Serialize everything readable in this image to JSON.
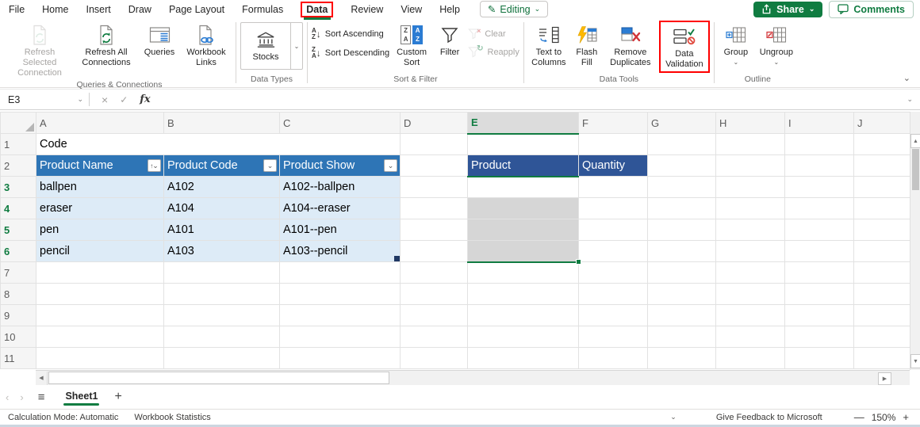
{
  "menu": {
    "items": [
      "File",
      "Home",
      "Insert",
      "Draw",
      "Page Layout",
      "Formulas",
      "Data",
      "Review",
      "View",
      "Help"
    ],
    "active": "Data",
    "editing_label": "Editing",
    "share_label": "Share",
    "comments_label": "Comments"
  },
  "ribbon": {
    "queries_group": {
      "label": "Queries & Connections",
      "refresh_selected": "Refresh Selected Connection",
      "refresh_all": "Refresh All Connections",
      "queries": "Queries",
      "workbook_links": "Workbook Links"
    },
    "data_types_group": {
      "label": "Data Types",
      "stocks": "Stocks"
    },
    "sort_filter_group": {
      "label": "Sort & Filter",
      "sort_ascending": "Sort Ascending",
      "sort_descending": "Sort Descending",
      "custom_sort": "Custom Sort",
      "filter": "Filter",
      "clear": "Clear",
      "reapply": "Reapply"
    },
    "data_tools_group": {
      "label": "Data Tools",
      "text_to_columns": "Text to Columns",
      "flash_fill": "Flash Fill",
      "remove_duplicates": "Remove Duplicates",
      "data_validation": "Data Validation"
    },
    "outline_group": {
      "label": "Outline",
      "group": "Group",
      "ungroup": "Ungroup"
    }
  },
  "formula_bar": {
    "cell_ref": "E3",
    "fx_label": "fx",
    "value": ""
  },
  "grid": {
    "columns": [
      "A",
      "B",
      "C",
      "D",
      "E",
      "F",
      "G",
      "H",
      "I",
      "J"
    ],
    "rows": [
      "1",
      "2",
      "3",
      "4",
      "5",
      "6",
      "7",
      "8",
      "9",
      "10",
      "11"
    ],
    "selected_column": "E",
    "selected_range": "E3:E6",
    "title_cell": "Code",
    "lookup_table": {
      "headers": [
        "Product Name",
        "Product Code",
        "Product Show"
      ],
      "rows": [
        [
          "ballpen",
          "A102",
          "A102--ballpen"
        ],
        [
          "eraser",
          "A104",
          "A104--eraser"
        ],
        [
          "pen",
          "A101",
          "A101--pen"
        ],
        [
          "pencil",
          "A103",
          "A103--pencil"
        ]
      ]
    },
    "entry_table": {
      "headers": [
        "Product",
        "Quantity"
      ]
    }
  },
  "sheet_bar": {
    "sheet_name": "Sheet1",
    "add_sheet": "+"
  },
  "status_bar": {
    "calculation_mode": "Calculation Mode: Automatic",
    "workbook_statistics": "Workbook Statistics",
    "feedback": "Give Feedback to Microsoft",
    "zoom_out": "—",
    "zoom_level": "150%",
    "zoom_in": "+"
  },
  "colors": {
    "accent_green": "#107C41",
    "lookup_header_blue": "#2E75B6",
    "entry_header_blue": "#2F5597",
    "lookup_fill_blue": "#DDEBF7",
    "callout_red": "#FF0000",
    "selection_gray": "#D6D6D6"
  }
}
